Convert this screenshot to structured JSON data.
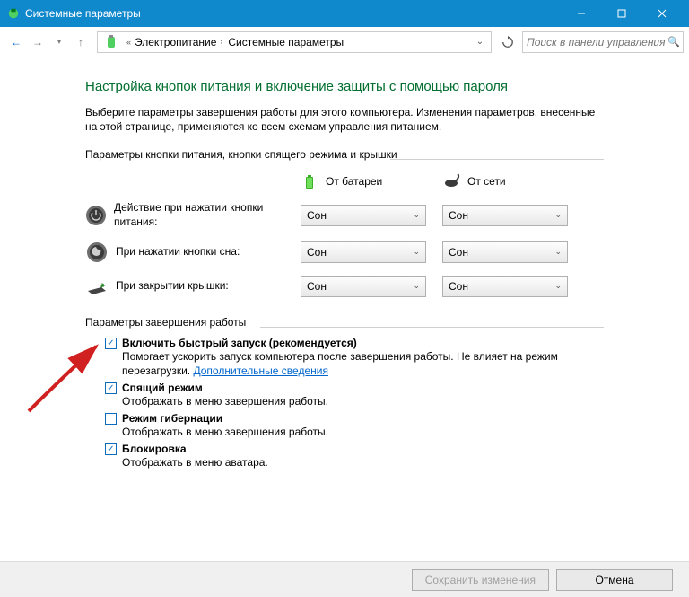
{
  "title": "Системные параметры",
  "breadcrumb": {
    "item1": "Электропитание",
    "item2": "Системные параметры"
  },
  "search": {
    "placeholder": "Поиск в панели управления"
  },
  "heading": "Настройка кнопок питания и включение защиты с помощью пароля",
  "intro": "Выберите параметры завершения работы для этого компьютера. Изменения параметров, внесенные на этой странице, применяются ко всем схемам управления питанием.",
  "section1_label": "Параметры кнопки питания, кнопки спящего режима и крышки",
  "cols": {
    "battery": "От батареи",
    "ac": "От сети"
  },
  "rows": {
    "power": {
      "label": "Действие при нажатии кнопки питания:",
      "val_batt": "Сон",
      "val_ac": "Сон"
    },
    "sleep": {
      "label": "При нажатии кнопки сна:",
      "val_batt": "Сон",
      "val_ac": "Сон"
    },
    "lid": {
      "label": "При закрытии крышки:",
      "val_batt": "Сон",
      "val_ac": "Сон"
    }
  },
  "section2_label": "Параметры завершения работы",
  "checks": {
    "faststart": {
      "checked": true,
      "title": "Включить быстрый запуск (рекомендуется)",
      "desc": "Помогает ускорить запуск компьютера после завершения работы. Не влияет на режим перезагрузки.",
      "link": "Дополнительные сведения"
    },
    "sleep": {
      "checked": true,
      "title": "Спящий режим",
      "desc": "Отображать в меню завершения работы."
    },
    "hibernate": {
      "checked": false,
      "title": "Режим гибернации",
      "desc": "Отображать в меню завершения работы."
    },
    "lock": {
      "checked": true,
      "title": "Блокировка",
      "desc": "Отображать в меню аватара."
    }
  },
  "buttons": {
    "save": "Сохранить изменения",
    "cancel": "Отмена"
  },
  "icons": {
    "back": "←",
    "fwd": "→",
    "up": "↑",
    "check": "✓"
  }
}
